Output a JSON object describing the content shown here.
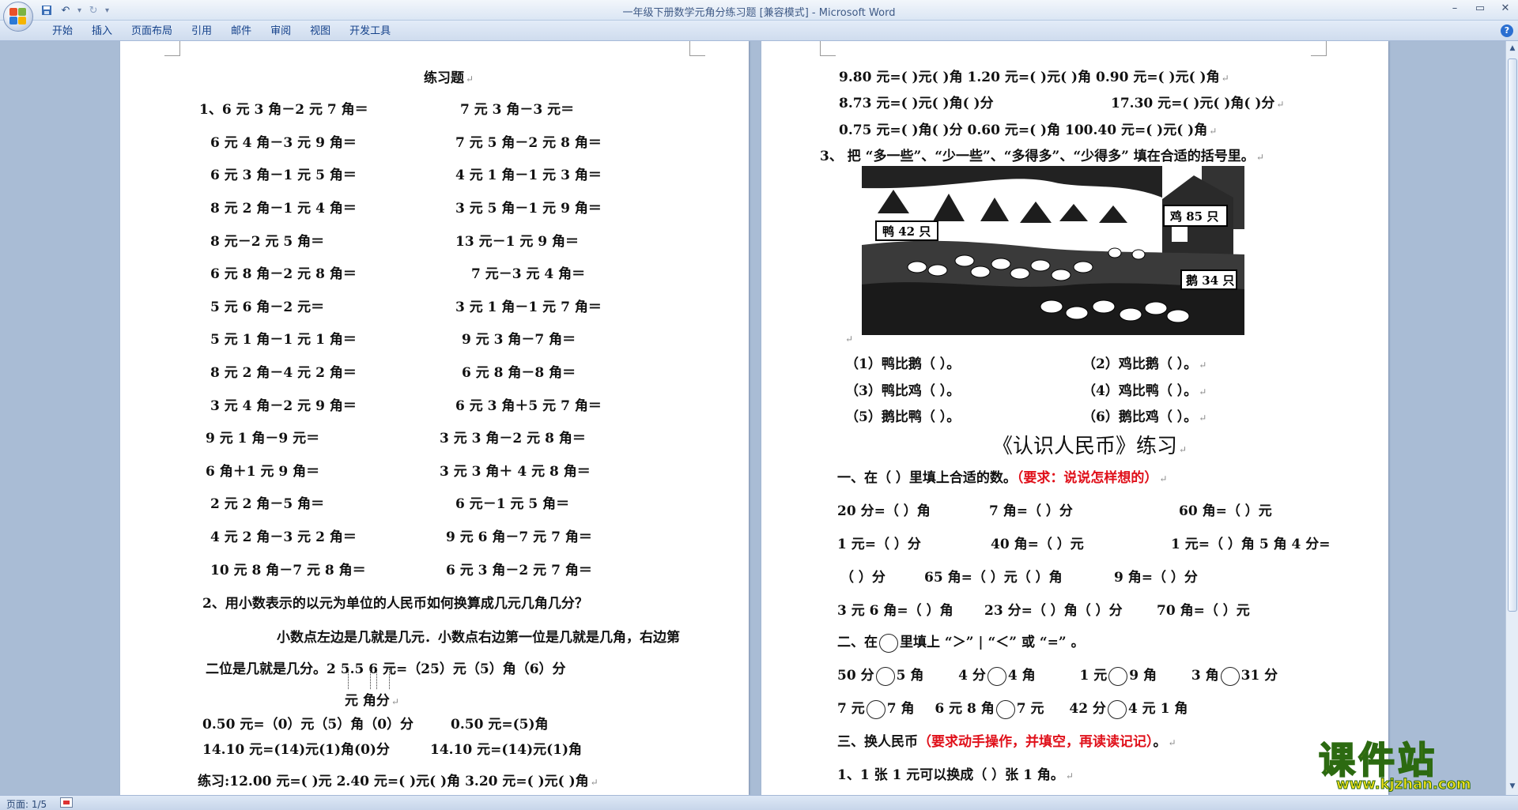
{
  "window": {
    "title": "一年级下册数学元角分练习题 [兼容模式] - Microsoft Word"
  },
  "quick_access": {
    "save_icon": "save-icon",
    "undo_icon": "undo-icon",
    "redo_icon": "redo-icon",
    "customize_icon": "customize-qat-icon"
  },
  "ribbon": {
    "tabs": [
      "开始",
      "插入",
      "页面布局",
      "引用",
      "邮件",
      "审阅",
      "视图",
      "开发工具"
    ]
  },
  "status": {
    "page": "页面: 1/5"
  },
  "watermark": {
    "title": "课件站",
    "url": "www.kjzhan.com"
  },
  "left_page": {
    "title": "练习题",
    "q1_rows": [
      [
        "1、6 元 3 角－2 元 7 角＝",
        "7 元 3 角－3 元＝"
      ],
      [
        "6 元 4 角－3 元 9 角＝",
        "7 元 5 角－2 元 8 角＝"
      ],
      [
        "6 元 3 角－1 元 5 角＝",
        "4 元 1 角－1 元 3 角＝"
      ],
      [
        "8 元 2 角－1 元 4 角＝",
        "3 元 5 角－1 元 9 角＝"
      ],
      [
        "8 元－2 元 5 角＝",
        "13 元－1 元 9 角＝"
      ],
      [
        "6 元 8 角－2 元 8 角＝",
        "7 元－3 元 4 角＝"
      ],
      [
        "5 元 6 角－2 元＝",
        "3 元 1 角－1 元 7 角＝"
      ],
      [
        "5 元 1 角－1 元 1 角＝",
        "9 元 3 角－7 角＝"
      ],
      [
        "8 元 2 角－4 元 2 角＝",
        "6 元 8 角－8 角＝"
      ],
      [
        "3 元 4 角－2 元 9 角＝",
        "6 元 3 角＋5 元 7 角＝"
      ],
      [
        "9 元 1 角－9 元＝",
        "3 元 3 角－2 元 8 角＝"
      ],
      [
        "6 角＋1 元 9 角＝",
        "3 元 3 角＋ 4 元 8 角＝"
      ],
      [
        "2 元 2 角－5 角＝",
        "6 元－1 元 5 角＝"
      ],
      [
        "4 元 2 角－3 元 2 角＝",
        "9 元 6 角－7 元 7 角＝"
      ],
      [
        "10 元 8 角－7 元 8 角＝",
        "6 元 3 角－2 元 7 角＝"
      ]
    ],
    "q2_title": "2、用小数表示的以元为单位的人民币如何换算成几元几角几分？",
    "q2_line1": "小数点左边是几就是几元．小数点右边第一位是几就是几角，右边第",
    "q2_line2": "二位是几就是几分。2 5.5 6 元=（25）元（5）角（6）分",
    "q2_units": "元  角分",
    "ex1": "0.50 元=（0）元（5）角（0）分",
    "ex2": "0.50 元=(5)角",
    "ex3": "14.10 元=(14)元(1)角(0)分",
    "ex4": "14.10 元=(14)元(1)角",
    "practice": "练习:12.00 元=(   )元    2.40 元=(   )元(   )角   3.20 元=(   )元(   )角"
  },
  "right_page": {
    "conv_row1": "9.80 元=(   )元(   )角   1.20 元=(   )元(   )角    0.90 元=(   )元(   )角",
    "conv_row2a": "8.73 元=(   )元(   )角(   )分",
    "conv_row2b": "17.30 元=(   )元(   )角(   )分",
    "conv_row3": "0.75 元=(   )角(   )分   0.60 元=(   )角      100.40 元=(   )元(   )角",
    "q3_title": "3、  把 “多一些”、“少一些”、“多得多”、“少得多” 填在合适的括号里。",
    "signs": {
      "duck": "鸭 42 只",
      "chicken": "鸡 85 只",
      "goose": "鹅 34 只"
    },
    "compare": [
      [
        "（1）鸭比鹅（            ）。",
        "（2）鸡比鹅（            ）。"
      ],
      [
        "（3）鸭比鸡（            ）。",
        "（4）鸡比鸭（            ）。"
      ],
      [
        "（5）鹅比鸭（            ）。",
        "（6）鹅比鸡（            ）。"
      ]
    ],
    "section_title": "《认识人民币》练习",
    "s1_title": "一、在（  ）里填上合适的数。",
    "s1_req": "（要求：说说怎样想的）",
    "s1_rows": [
      [
        "20 分=（    ）角",
        "7 角=（    ）分",
        "60 角=（    ）元"
      ],
      [
        "1 元=（      ）分",
        "40 角=（    ）元",
        "1 元=（      ）角 5 角 4 分="
      ],
      [
        "（   ）分",
        "65 角=（    ）元（    ）角",
        "9 角=（    ）分"
      ],
      [
        "3 元 6 角=（   ）角",
        "23 分=（ ）角（   ）分",
        "70 角=（    ）元"
      ]
    ],
    "s2_title": "二、在",
    "s2_title_after": "里填上 “＞” | “＜” 或 “=” 。",
    "s2_row1": [
      [
        "50 分",
        "5 角"
      ],
      [
        "4 分",
        "4 角"
      ],
      [
        "1 元",
        "9 角"
      ],
      [
        "3 角",
        "31 分"
      ]
    ],
    "s2_row2": [
      [
        "7 元",
        "7 角"
      ],
      [
        "6 元 8 角",
        "7 元"
      ],
      [
        "42 分",
        "4 元 1 角"
      ]
    ],
    "s3_title": "三、换人民币",
    "s3_req": "（要求动手操作，并填空，再读读记记）",
    "s3_end": "。",
    "s3_item1": "1、1 张 1 元可以换成（     ）张 1 角。"
  }
}
